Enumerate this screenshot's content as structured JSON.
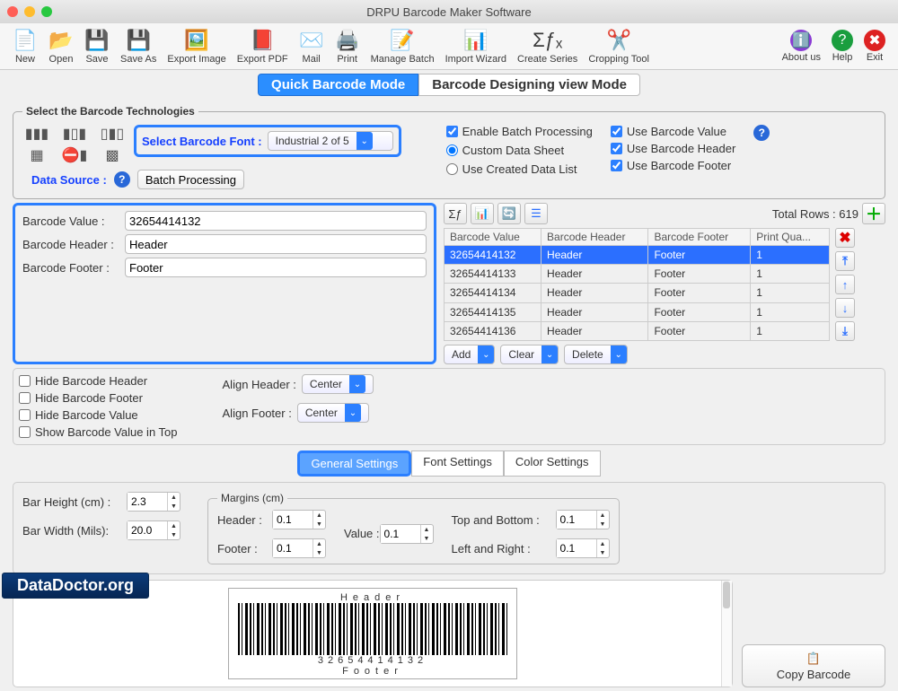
{
  "title": "DRPU Barcode Maker Software",
  "toolbar": [
    {
      "label": "New",
      "icon": "📄"
    },
    {
      "label": "Open",
      "icon": "📂"
    },
    {
      "label": "Save",
      "icon": "💾"
    },
    {
      "label": "Save As",
      "icon": "💾"
    },
    {
      "label": "Export Image",
      "icon": "🖼️"
    },
    {
      "label": "Export PDF",
      "icon": "📕"
    },
    {
      "label": "Mail",
      "icon": "✉️"
    },
    {
      "label": "Print",
      "icon": "🖨️"
    },
    {
      "label": "Manage Batch",
      "icon": "📝"
    },
    {
      "label": "Import Wizard",
      "icon": "📊"
    },
    {
      "label": "Create Series",
      "icon": "Σƒₓ"
    },
    {
      "label": "Cropping Tool",
      "icon": "✂️"
    }
  ],
  "toolbar_right": [
    {
      "label": "About us",
      "icon": "ℹ️",
      "color": "#8a3bd4"
    },
    {
      "label": "Help",
      "icon": "?",
      "color": "#1a9e3e"
    },
    {
      "label": "Exit",
      "icon": "✖",
      "color": "#d22"
    }
  ],
  "modes": {
    "quick": "Quick Barcode Mode",
    "design": "Barcode Designing view Mode"
  },
  "tech": {
    "legend": "Select the Barcode Technologies",
    "font_label": "Select Barcode Font :",
    "font_value": "Industrial 2 of 5",
    "datasource_label": "Data Source :",
    "datasource_btn": "Batch Processing",
    "enable_batch": "Enable Batch Processing",
    "custom": "Custom Data Sheet",
    "created": "Use Created Data List",
    "use_val": "Use Barcode Value",
    "use_hd": "Use Barcode Header",
    "use_ft": "Use Barcode Footer"
  },
  "vals": {
    "value_lbl": "Barcode Value :",
    "header_lbl": "Barcode Header :",
    "footer_lbl": "Barcode Footer :",
    "value": "32654414132",
    "header": "Header",
    "footer": "Footer"
  },
  "batch": {
    "total_label": "Total Rows :",
    "total": "619",
    "headers": [
      "Barcode Value",
      "Barcode Header",
      "Barcode Footer",
      "Print Qua..."
    ],
    "rows": [
      [
        "32654414132",
        "Header",
        "Footer",
        "1"
      ],
      [
        "32654414133",
        "Header",
        "Footer",
        "1"
      ],
      [
        "32654414134",
        "Header",
        "Footer",
        "1"
      ],
      [
        "32654414135",
        "Header",
        "Footer",
        "1"
      ],
      [
        "32654414136",
        "Header",
        "Footer",
        "1"
      ]
    ],
    "actions": [
      "Add",
      "Clear",
      "Delete"
    ]
  },
  "hide": {
    "hd": "Hide Barcode Header",
    "ft": "Hide Barcode Footer",
    "val": "Hide Barcode Value",
    "top": "Show Barcode Value in Top"
  },
  "align": {
    "header_lbl": "Align Header :",
    "footer_lbl": "Align Footer :",
    "val": "Center"
  },
  "tabs": {
    "general": "General Settings",
    "font": "Font Settings",
    "color": "Color Settings"
  },
  "settings": {
    "bar_height_lbl": "Bar Height (cm) :",
    "bar_height": "2.3",
    "bar_width_lbl": "Bar Width (Mils):",
    "bar_width": "20.0",
    "margins_legend": "Margins (cm)",
    "m_header_lbl": "Header :",
    "m_footer_lbl": "Footer :",
    "m_value_lbl": "Value :",
    "m_tb_lbl": "Top and Bottom :",
    "m_lr_lbl": "Left and Right :",
    "m": "0.1"
  },
  "preview": {
    "header": "Header",
    "footer": "Footer",
    "value": "32654414132"
  },
  "copy_label": "Copy Barcode",
  "watermark": "DataDoctor.org"
}
